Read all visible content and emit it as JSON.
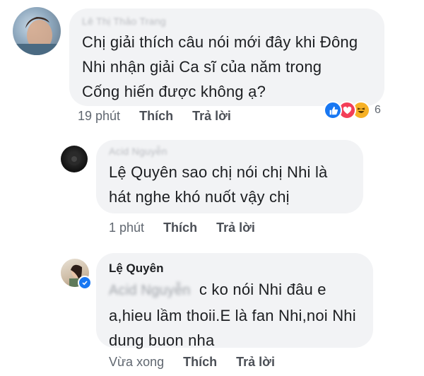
{
  "comments": [
    {
      "author": "Lê Thị Thảo Trang",
      "lines": [
        "Chị giải thích câu nói mới đây khi Đông",
        "Nhi nhận giải Ca sĩ của năm trong",
        "Cống hiến được không ạ?"
      ],
      "time": "19 phút",
      "like_label": "Thích",
      "reply_label": "Trả lời",
      "reactions": {
        "icons": [
          "like-icon",
          "love-icon",
          "haha-icon"
        ],
        "count": "6"
      }
    },
    {
      "author": "Acid Nguyễn",
      "lines": [
        "Lệ Quyên  sao chị nói chị Nhi là",
        "hát nghe khó nuốt vậy chị"
      ],
      "time": "1 phút",
      "like_label": "Thích",
      "reply_label": "Trả lời"
    },
    {
      "author": "Lệ Quyên",
      "mention": "Acid Nguyễn",
      "lines": [
        "c ko nói Nhi đâu e",
        "a,hieu lầm thoii.E là fan Nhi,noi Nhi",
        "dung buon nha"
      ],
      "time": "Vừa xong",
      "like_label": "Thích",
      "reply_label": "Trả lời"
    }
  ],
  "colors": {
    "bubble": "#f2f3f5",
    "like": "#1877f2",
    "love": "#f33e58",
    "haha": "#f7b125",
    "verified": "#1877f2"
  }
}
